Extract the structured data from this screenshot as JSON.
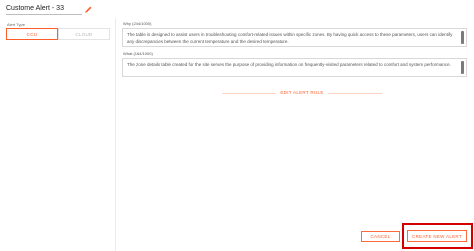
{
  "header": {
    "title": "Custome Alert - 33"
  },
  "alert_type": {
    "label": "Alert Type",
    "options": [
      "CCU",
      "CLOUD"
    ],
    "selected": "CCU"
  },
  "why": {
    "label": "Why (244/1000)",
    "text": "The table is designed to assist users in troubleshooting comfort-related issues within specific zones. By having quick access to these parameters, users can identify any discrepancies between the current temperature and the desired temperature."
  },
  "what": {
    "label": "What (164/1000)",
    "text": "The zone details table created for the site serves the purpose of providing information on frequently-visited parameters related to comfort and system performance."
  },
  "edit_rule_label": "EDIT ALERT RULE",
  "footer": {
    "cancel_label": "CANCEL",
    "create_label": "CREATE NEW ALERT"
  },
  "colors": {
    "accent": "#ff5c2b",
    "highlight_box": "#d40000"
  },
  "icons": {
    "edit": "pencil-icon"
  }
}
